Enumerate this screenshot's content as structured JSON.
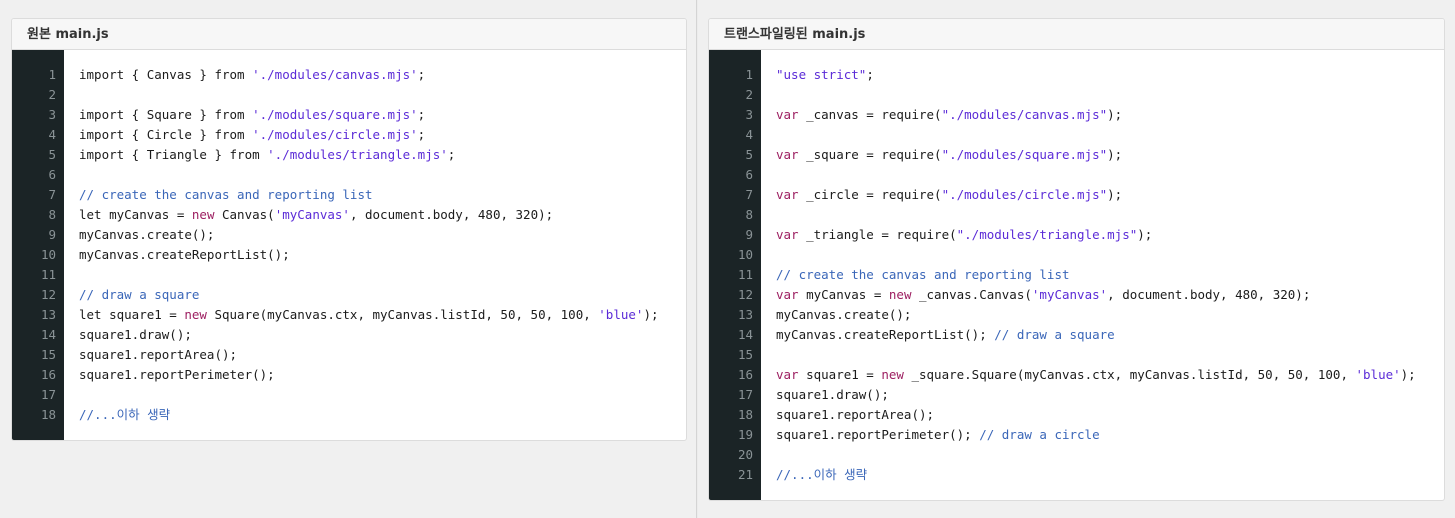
{
  "left_panel": {
    "title": "원본 main.js",
    "lines": [
      [
        {
          "t": "import { Canvas } from "
        },
        {
          "t": "'./modules/canvas.mjs'",
          "k": "str"
        },
        {
          "t": ";"
        }
      ],
      [],
      [
        {
          "t": "import { Square } from "
        },
        {
          "t": "'./modules/square.mjs'",
          "k": "str"
        },
        {
          "t": ";"
        }
      ],
      [
        {
          "t": "import { Circle } from "
        },
        {
          "t": "'./modules/circle.mjs'",
          "k": "str"
        },
        {
          "t": ";"
        }
      ],
      [
        {
          "t": "import { Triangle } from "
        },
        {
          "t": "'./modules/triangle.mjs'",
          "k": "str"
        },
        {
          "t": ";"
        }
      ],
      [],
      [
        {
          "t": "// create the canvas and reporting list",
          "k": "cm"
        }
      ],
      [
        {
          "t": "let myCanvas = "
        },
        {
          "t": "new",
          "k": "kw"
        },
        {
          "t": " Canvas("
        },
        {
          "t": "'myCanvas'",
          "k": "str"
        },
        {
          "t": ", document.body, 480, 320);"
        }
      ],
      [
        {
          "t": "myCanvas.create();"
        }
      ],
      [
        {
          "t": "myCanvas.createReportList();"
        }
      ],
      [],
      [
        {
          "t": "// draw a square",
          "k": "cm"
        }
      ],
      [
        {
          "t": "let square1 = "
        },
        {
          "t": "new",
          "k": "kw"
        },
        {
          "t": " Square(myCanvas.ctx, myCanvas.listId, 50, 50, 100, "
        },
        {
          "t": "'blue'",
          "k": "str"
        },
        {
          "t": ");"
        }
      ],
      [
        {
          "t": "square1.draw();"
        }
      ],
      [
        {
          "t": "square1.reportArea();"
        }
      ],
      [
        {
          "t": "square1.reportPerimeter();"
        }
      ],
      [],
      [
        {
          "t": "//...이하 생략",
          "k": "cm"
        }
      ]
    ]
  },
  "right_panel": {
    "title": "트랜스파일링된 main.js",
    "lines": [
      [
        {
          "t": "\"use strict\"",
          "k": "str"
        },
        {
          "t": ";"
        }
      ],
      [],
      [
        {
          "t": "var",
          "k": "kw"
        },
        {
          "t": " _canvas = require("
        },
        {
          "t": "\"./modules/canvas.mjs\"",
          "k": "str"
        },
        {
          "t": ");"
        }
      ],
      [],
      [
        {
          "t": "var",
          "k": "kw"
        },
        {
          "t": " _square = require("
        },
        {
          "t": "\"./modules/square.mjs\"",
          "k": "str"
        },
        {
          "t": ");"
        }
      ],
      [],
      [
        {
          "t": "var",
          "k": "kw"
        },
        {
          "t": " _circle = require("
        },
        {
          "t": "\"./modules/circle.mjs\"",
          "k": "str"
        },
        {
          "t": ");"
        }
      ],
      [],
      [
        {
          "t": "var",
          "k": "kw"
        },
        {
          "t": " _triangle = require("
        },
        {
          "t": "\"./modules/triangle.mjs\"",
          "k": "str"
        },
        {
          "t": ");"
        }
      ],
      [],
      [
        {
          "t": "// create the canvas and reporting list",
          "k": "cm"
        }
      ],
      [
        {
          "t": "var",
          "k": "kw"
        },
        {
          "t": " myCanvas = "
        },
        {
          "t": "new",
          "k": "kw"
        },
        {
          "t": " _canvas.Canvas("
        },
        {
          "t": "'myCanvas'",
          "k": "str"
        },
        {
          "t": ", document.body, 480, 320);"
        }
      ],
      [
        {
          "t": "myCanvas.create();"
        }
      ],
      [
        {
          "t": "myCanvas.createReportList(); "
        },
        {
          "t": "// draw a square",
          "k": "cm"
        }
      ],
      [],
      [
        {
          "t": "var",
          "k": "kw"
        },
        {
          "t": " square1 = "
        },
        {
          "t": "new",
          "k": "kw"
        },
        {
          "t": " _square.Square(myCanvas.ctx, myCanvas.listId, 50, 50, 100, "
        },
        {
          "t": "'blue'",
          "k": "str"
        },
        {
          "t": ");"
        }
      ],
      [
        {
          "t": "square1.draw();"
        }
      ],
      [
        {
          "t": "square1.reportArea();"
        }
      ],
      [
        {
          "t": "square1.reportPerimeter(); "
        },
        {
          "t": "// draw a circle",
          "k": "cm"
        }
      ],
      [],
      [
        {
          "t": "//...이하 생략",
          "k": "cm"
        }
      ]
    ]
  }
}
